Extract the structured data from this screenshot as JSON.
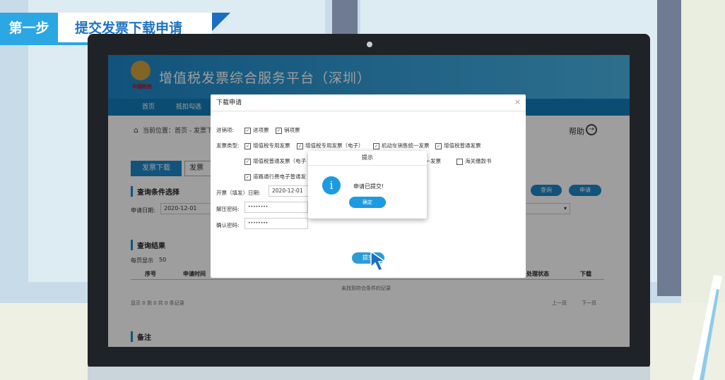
{
  "step": {
    "number": "第一步",
    "title": "提交发票下载申请"
  },
  "site": {
    "title": "增值税发票综合服务平台（深圳）",
    "emblem_caption": "中国税务",
    "user_info": "",
    "nav": [
      "首页",
      "抵扣勾选"
    ]
  },
  "page": {
    "breadcrumb": "当前位置：首页 - 发票下载",
    "help": "帮助",
    "tabs": [
      "发票下载",
      "发票"
    ],
    "query_section": "查询条件选择",
    "apply_date_label": "申请日期:",
    "apply_date_value": "2020-12-01",
    "query_button": "查询",
    "apply_button": "申请",
    "results_section": "查询结果",
    "per_page_label": "每页显示",
    "per_page_value": "50",
    "columns": [
      "序号",
      "申请时间",
      "处理状态",
      "下载"
    ],
    "empty_text": "未找到符合条件的记录",
    "footer_text": "显示 0 到 0 共 0 条记录",
    "prev": "上一页",
    "next": "下一页",
    "notes_section": "备注"
  },
  "modal": {
    "title": "下载申请",
    "close": "×",
    "item_label": "进销项:",
    "items": [
      "进项票",
      "销项票"
    ],
    "type_label": "发票类型:",
    "types_row1": [
      "增值税专用发票",
      "增值税专用发票（电子）",
      "机动车销售统一发票",
      "增值税普通发票"
    ],
    "types_row2": [
      "增值税普通发票（电子",
      "统一发票",
      "海关缴款书"
    ],
    "types_row3": [
      "道路通行费电子普通发"
    ],
    "date_label": "开票（填发）日期:",
    "date_value": "2020-12-01",
    "pwd_label": "解压密码:",
    "pwd_value": "••••••••",
    "confirm_label": "确认密码:",
    "confirm_value": "••••••••",
    "submit": "提交"
  },
  "alert": {
    "title": "提示",
    "message": "申请已提交!",
    "ok": "确定",
    "icon": "i"
  }
}
